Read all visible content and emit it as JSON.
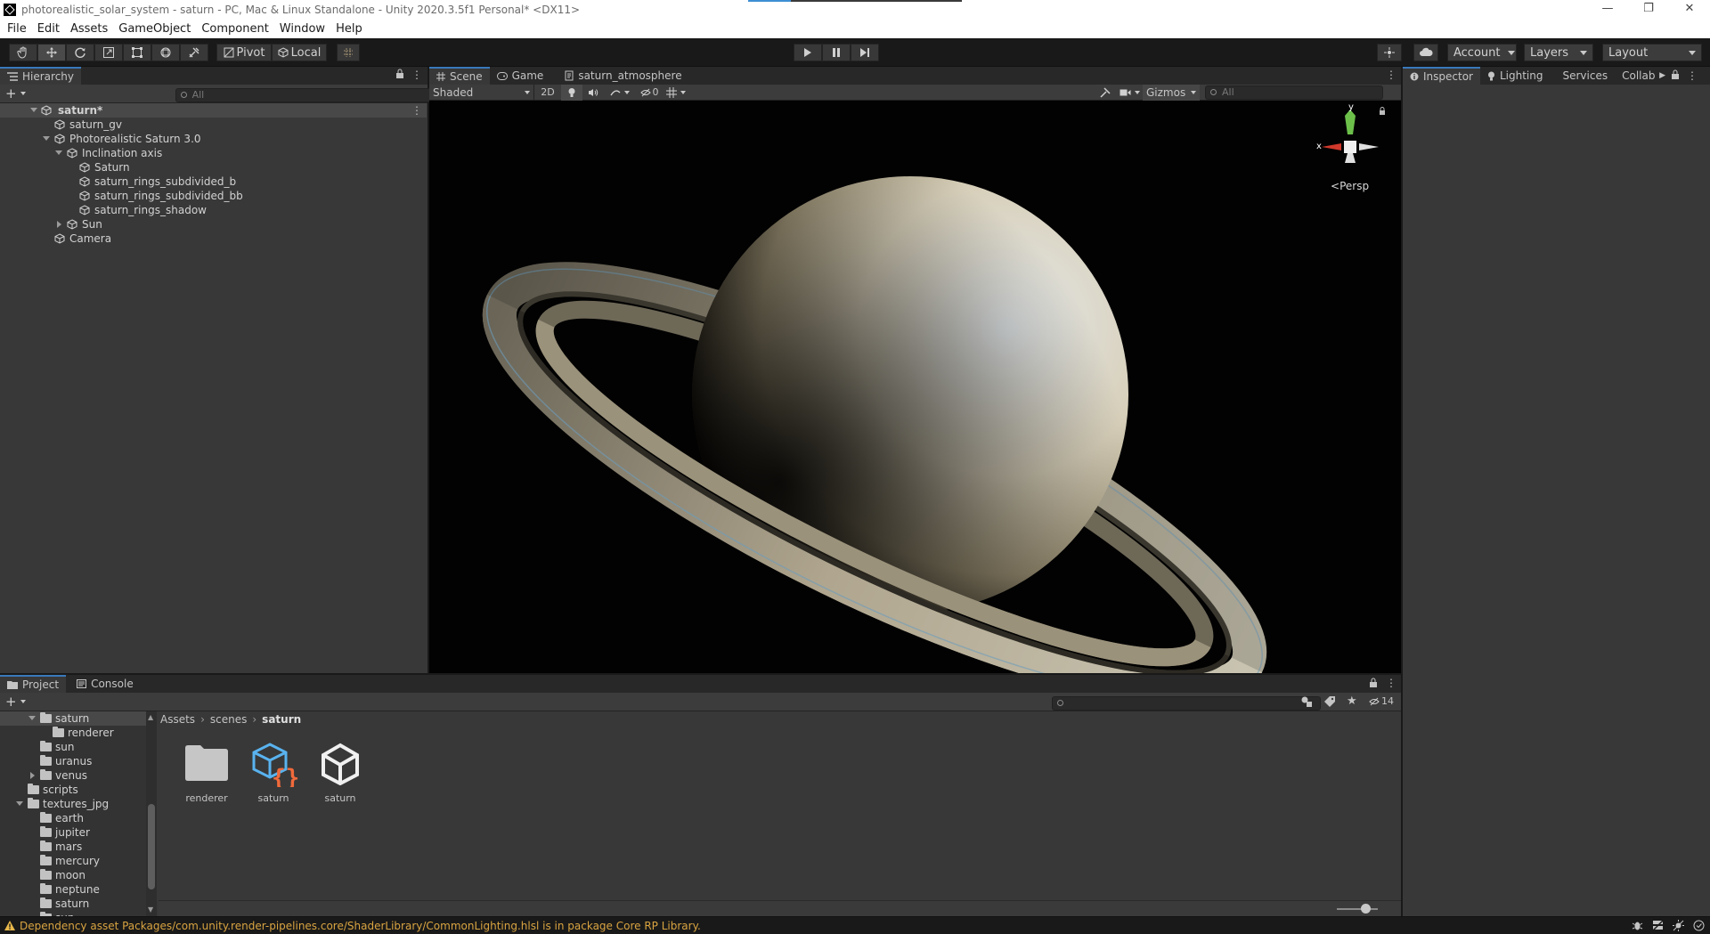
{
  "window": {
    "title": "photorealistic_solar_system - saturn - PC, Mac & Linux Standalone - Unity 2020.3.5f1 Personal* <DX11>",
    "minimize": "—",
    "maximize": "❐",
    "close": "✕"
  },
  "menu": [
    "File",
    "Edit",
    "Assets",
    "GameObject",
    "Component",
    "Window",
    "Help"
  ],
  "toolbar": {
    "pivot_label": "Pivot",
    "local_label": "Local",
    "account_label": "Account",
    "layers_label": "Layers",
    "layout_label": "Layout"
  },
  "hierarchy": {
    "tab_label": "Hierarchy",
    "search_placeholder": "All",
    "scene_name": "saturn*",
    "items": [
      {
        "label": "saturn_gv"
      },
      {
        "label": "Photorealistic Saturn 3.0"
      },
      {
        "label": "Inclination axis"
      },
      {
        "label": "Saturn"
      },
      {
        "label": "saturn_rings_subdivided_b"
      },
      {
        "label": "saturn_rings_subdivided_bb"
      },
      {
        "label": "saturn_rings_shadow"
      },
      {
        "label": "Sun"
      },
      {
        "label": "Camera"
      }
    ]
  },
  "scene_tabs": [
    "Scene",
    "Game",
    "saturn_atmosphere"
  ],
  "scene_bar": {
    "draw_mode": "Shaded",
    "mode_2d": "2D",
    "hidden_count": "0",
    "gizmos_label": "Gizmos",
    "search_placeholder": "All"
  },
  "gizmo": {
    "x_label": "x",
    "y_label": "y",
    "persp_label": "Persp"
  },
  "right_tabs": [
    "Inspector",
    "Lighting",
    "Services",
    "Collab"
  ],
  "project": {
    "tabs": [
      "Project",
      "Console"
    ],
    "breadcrumb": [
      "Assets",
      "scenes",
      "saturn"
    ],
    "hidden_count": "14",
    "tree": [
      {
        "label": "saturn"
      },
      {
        "label": "renderer"
      },
      {
        "label": "sun"
      },
      {
        "label": "uranus"
      },
      {
        "label": "venus"
      },
      {
        "label": "scripts"
      },
      {
        "label": "textures_jpg"
      },
      {
        "label": "earth"
      },
      {
        "label": "jupiter"
      },
      {
        "label": "mars"
      },
      {
        "label": "mercury"
      },
      {
        "label": "moon"
      },
      {
        "label": "neptune"
      },
      {
        "label": "saturn"
      },
      {
        "label": "sun"
      }
    ],
    "assets": [
      {
        "label": "renderer",
        "icon": "folder-icon"
      },
      {
        "label": "saturn",
        "icon": "prefab-script-icon"
      },
      {
        "label": "saturn",
        "icon": "unity-scene-icon"
      }
    ]
  },
  "status": {
    "message": "Dependency asset Packages/com.unity.render-pipelines.core/ShaderLibrary/CommonLighting.hlsl is in package Core RP Library."
  },
  "colors": {
    "selection_tab": "#3a79bb",
    "warning": "#d9a441",
    "gizmo_x": "#d0392b",
    "gizmo_y": "#6cc04a"
  }
}
